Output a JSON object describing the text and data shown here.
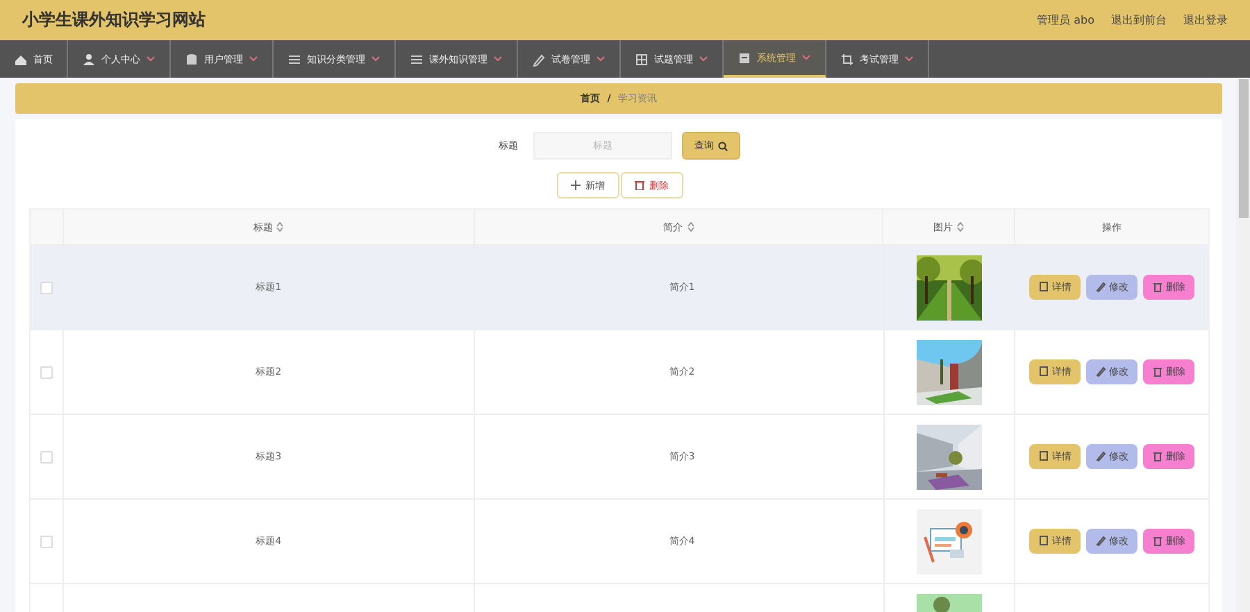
{
  "header": {
    "site_title": "小学生课外知识学习网站",
    "links": [
      "管理员 abo",
      "退出到前台",
      "退出登录"
    ]
  },
  "nav": [
    {
      "label": "首页",
      "dropdown": false,
      "selected": false
    },
    {
      "label": "个人中心",
      "dropdown": true,
      "selected": false
    },
    {
      "label": "用户管理",
      "dropdown": true,
      "selected": false
    },
    {
      "label": "知识分类管理",
      "dropdown": true,
      "selected": false
    },
    {
      "label": "课外知识管理",
      "dropdown": true,
      "selected": false
    },
    {
      "label": "试卷管理",
      "dropdown": true,
      "selected": false
    },
    {
      "label": "试题管理",
      "dropdown": true,
      "selected": false
    },
    {
      "label": "系统管理",
      "dropdown": true,
      "selected": true
    },
    {
      "label": "考试管理",
      "dropdown": true,
      "selected": false
    }
  ],
  "breadcrumb": {
    "home": "首页",
    "separator": "/",
    "current": "学习资讯"
  },
  "search": {
    "label": "标题",
    "placeholder": "标题",
    "button": "查询"
  },
  "actions": {
    "add": "新增",
    "delete": "删除"
  },
  "table": {
    "columns": [
      {
        "label": "标题",
        "sortable": true
      },
      {
        "label": "简介",
        "sortable": true
      },
      {
        "label": "图片",
        "sortable": true
      },
      {
        "label": "操作",
        "sortable": false
      }
    ],
    "rows": [
      {
        "title": "标题1",
        "intro": "简介1",
        "checked": false,
        "hover": true,
        "image": {
          "kind": "picture"
        },
        "buttons": [
          "详情",
          "修改",
          "删除"
        ]
      },
      {
        "title": "标题2",
        "intro": "简介2",
        "checked": false,
        "hover": false,
        "image": {
          "kind": "picture"
        },
        "buttons": [
          "详情",
          "修改",
          "删除"
        ]
      },
      {
        "title": "标题3",
        "intro": "简介3",
        "checked": false,
        "hover": false,
        "image": {
          "kind": "picture"
        },
        "buttons": [
          "详情",
          "修改",
          "删除"
        ]
      },
      {
        "title": "标题4",
        "intro": "简介4",
        "checked": false,
        "hover": false,
        "image": {
          "kind": "picture"
        },
        "buttons": [
          "详情",
          "修改",
          "删除"
        ]
      },
      {
        "hover": false,
        "image": {
          "kind": "picture"
        }
      }
    ]
  }
}
